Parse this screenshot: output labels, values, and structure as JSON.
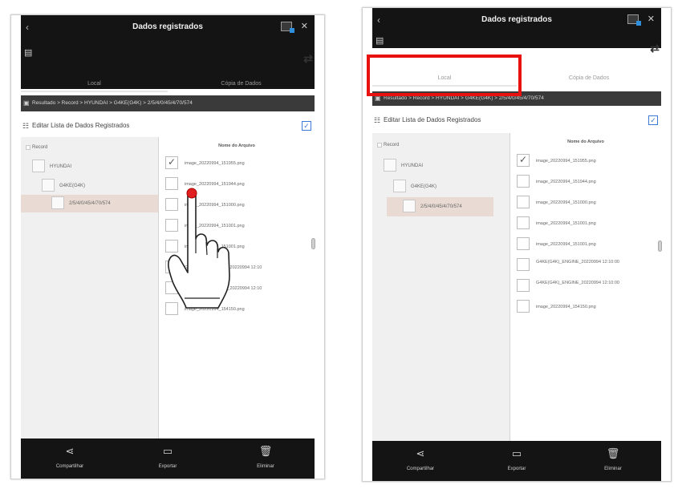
{
  "header": {
    "title": "Dados registrados"
  },
  "tabs": [
    "Local",
    "Cópia de Dados"
  ],
  "breadcrumb": "Resultado > Record > HYUNDAI > G4KE(G4K) > 2/5/4/0/45/4/70/574",
  "edit_label": "Editar Lista de Dados Registrados",
  "tree": {
    "root": "Record",
    "level1": "HYUNDAI",
    "level2": "G4KE(G4K)",
    "level3": "2/5/4/0/45/4/70/574"
  },
  "files_header": "Nome do Arquivo",
  "left_files": [
    {
      "name": "image_20220994_151955.png",
      "checked": true
    },
    {
      "name": "image_20220994_151944.png",
      "checked": false
    },
    {
      "name": "image_20220994_151000.png",
      "checked": false
    },
    {
      "name": "image_20220994_151001.png",
      "checked": false
    },
    {
      "name": "image_20220994_151001.png",
      "checked": false
    },
    {
      "name": "G4KE(G4K)_ENGINE_20220994 12:10",
      "checked": false
    },
    {
      "name": "G4KE(G4K)_ENGINE_20220994 12:10",
      "checked": false
    },
    {
      "name": "image_20220994_154150.png",
      "checked": false
    }
  ],
  "right_files": [
    {
      "name": "image_20220994_151955.png",
      "checked": true
    },
    {
      "name": "image_20220994_151944.png",
      "checked": false
    },
    {
      "name": "image_20220994_151000.png",
      "checked": false
    },
    {
      "name": "image_20220994_151001.png",
      "checked": false
    },
    {
      "name": "image_20220994_151001.png",
      "checked": false
    },
    {
      "name": "G4KE(G4K)_ENGINE_20220994 12:10:00",
      "checked": false
    },
    {
      "name": "G4KE(G4K)_ENGINE_20220994 12:10:00",
      "checked": false
    },
    {
      "name": "image_20220994_154150.png",
      "checked": false
    }
  ],
  "bottom": {
    "share": "Compartilhar",
    "export": "Exportar",
    "delete": "Eliminar"
  },
  "icons": {
    "back": "back-icon",
    "screen": "screen-icon",
    "settings": "settings-icon",
    "swap": "swap-icon",
    "share": "share-icon",
    "export": "export-icon",
    "delete": "trash-icon"
  },
  "colors": {
    "highlight": "#e8110f",
    "selected_tree": "#e9dbd3",
    "check_all": "#3d7ad6"
  }
}
